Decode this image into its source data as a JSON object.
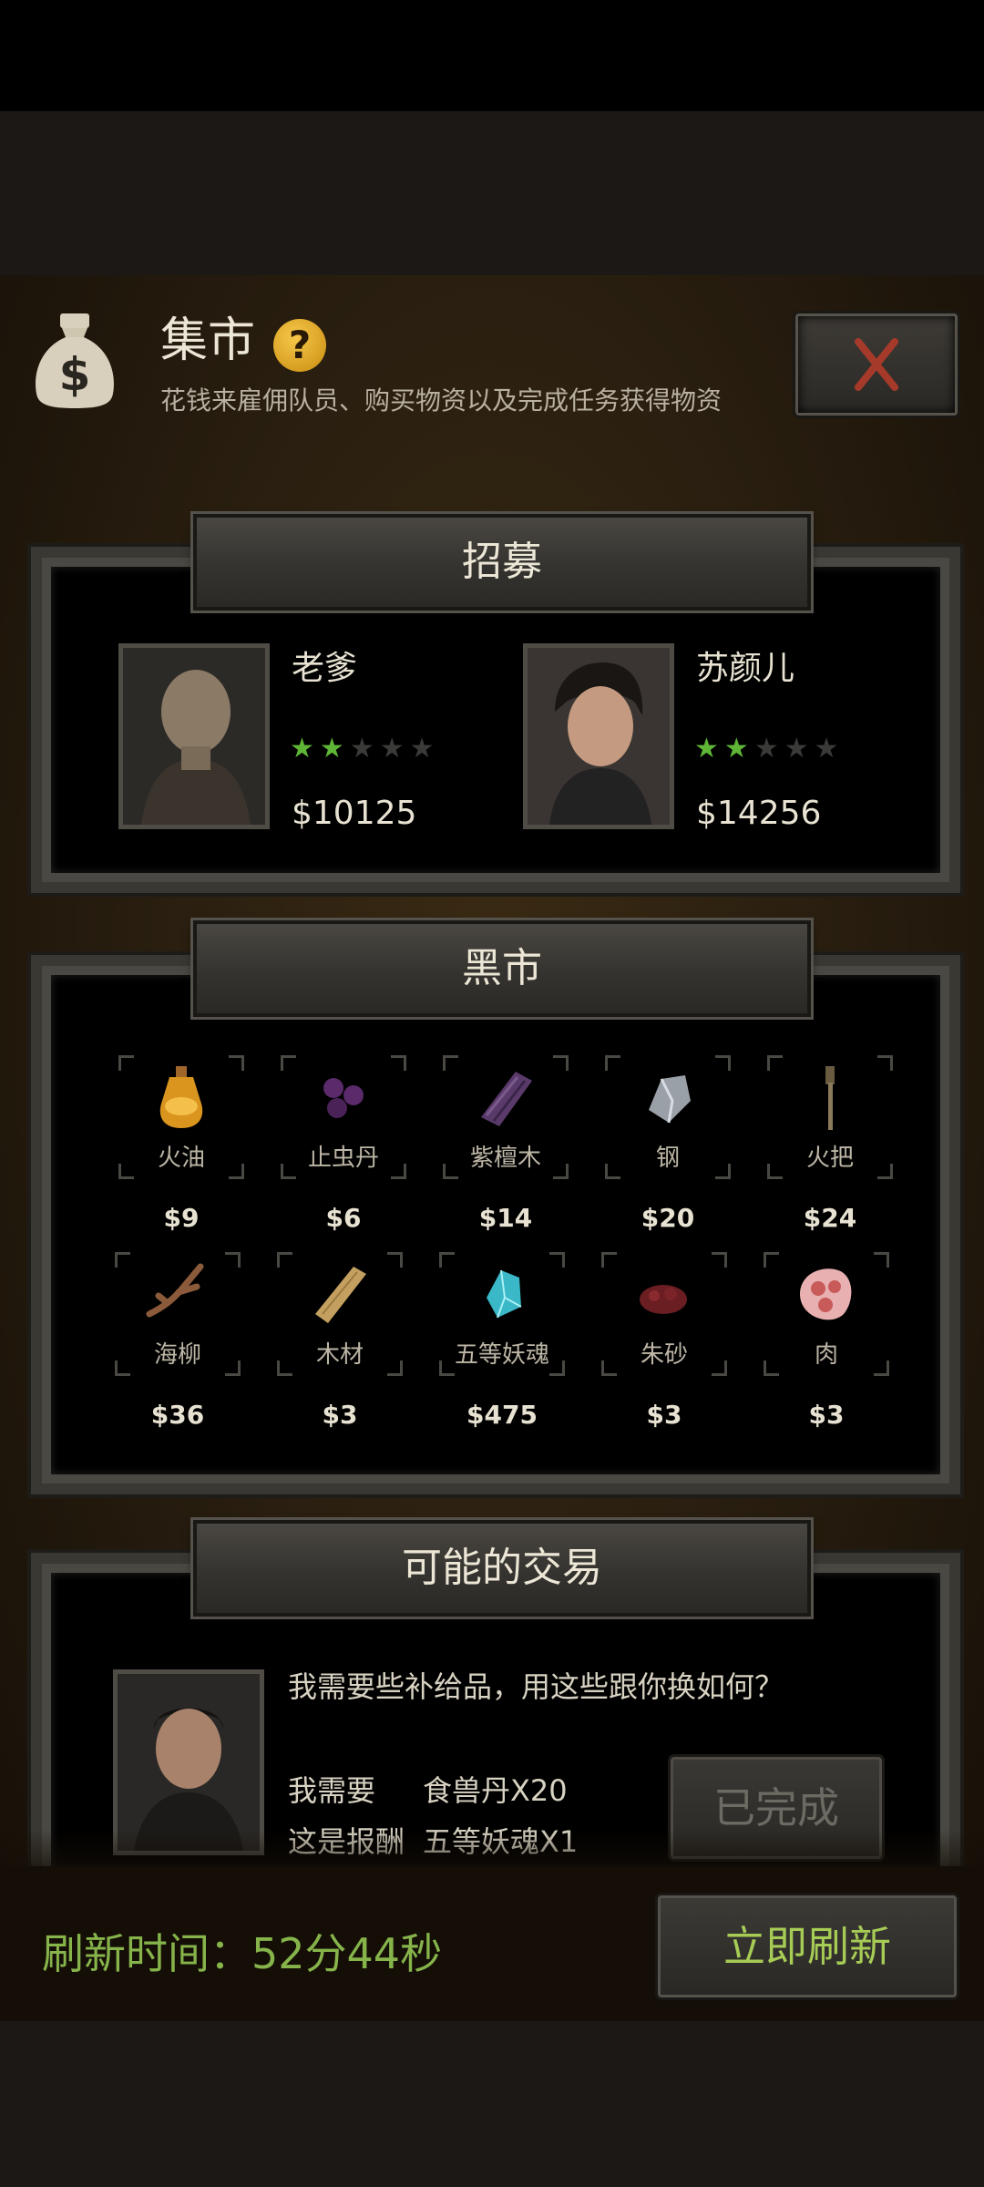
{
  "header": {
    "title": "集市",
    "help_icon": "?",
    "subtitle": "花钱来雇佣队员、购买物资以及完成任务获得物资",
    "bag_icon": "money-bag-icon",
    "close_icon": "close-x-icon"
  },
  "recruit": {
    "title": "招募",
    "members": [
      {
        "name": "老爹",
        "stars": 2,
        "max_stars": 5,
        "price": "$10125"
      },
      {
        "name": "苏颜儿",
        "stars": 2,
        "max_stars": 5,
        "price": "$14256"
      }
    ]
  },
  "market": {
    "title": "黑市",
    "items": [
      {
        "name": "火油",
        "price": "$9",
        "icon": "oil-bottle-icon"
      },
      {
        "name": "止虫丹",
        "price": "$6",
        "icon": "purple-pills-icon"
      },
      {
        "name": "紫檀木",
        "price": "$14",
        "icon": "purple-wood-icon"
      },
      {
        "name": "钢",
        "price": "$20",
        "icon": "steel-ore-icon"
      },
      {
        "name": "火把",
        "price": "$24",
        "icon": "torch-icon"
      },
      {
        "name": "海柳",
        "price": "$36",
        "icon": "branch-icon"
      },
      {
        "name": "木材",
        "price": "$3",
        "icon": "plank-icon"
      },
      {
        "name": "五等妖魂",
        "price": "$475",
        "icon": "crystal-icon"
      },
      {
        "name": "朱砂",
        "price": "$3",
        "icon": "cinnabar-icon"
      },
      {
        "name": "肉",
        "price": "$3",
        "icon": "meat-icon"
      }
    ]
  },
  "trade": {
    "title": "可能的交易",
    "message": "我需要些补给品，用这些跟你换如何？",
    "need_label": "我需要",
    "need_item": "食兽丹X20",
    "reward_label": "这是报酬",
    "reward_item": "五等妖魂X1",
    "done_label": "已完成"
  },
  "footer": {
    "refresh_time": "刷新时间：52分44秒",
    "refresh_button": "立即刷新"
  },
  "colors": {
    "accent_green": "#86b34a",
    "star_on": "#5fb535",
    "gold": "#f6c74a",
    "close_red": "#a63a2a"
  }
}
